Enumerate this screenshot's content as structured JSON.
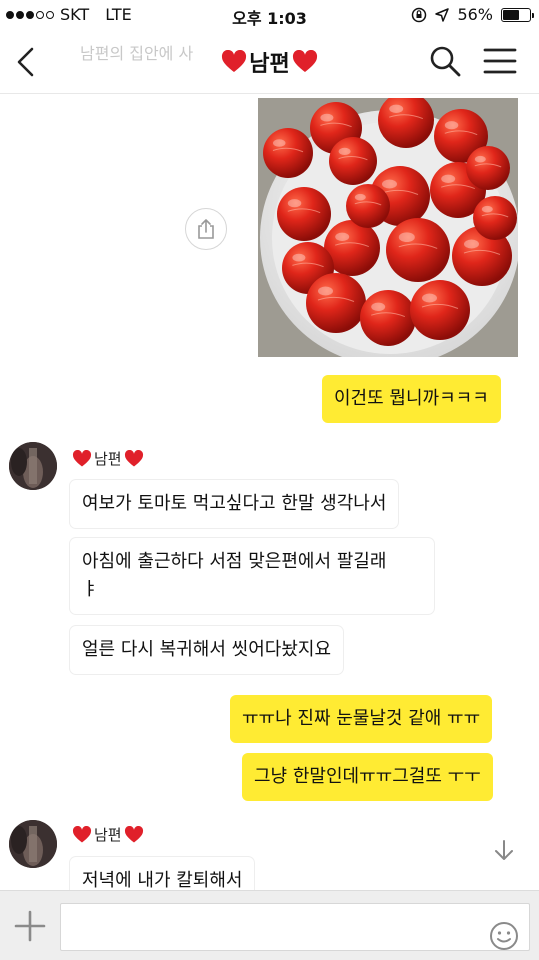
{
  "status_bar": {
    "carrier": "SKT",
    "network": "LTE",
    "time": "오후 1:03",
    "battery": "56%",
    "battery_level": 0.56
  },
  "header": {
    "title": "남편",
    "ghost_text": "남편의 집안에 사"
  },
  "messages": {
    "me_1": "이건또 뭡니까ㅋㅋㅋ",
    "sender_1": "남편",
    "them_1": "여보가 토마토 먹고싶다고 한말 생각나서",
    "them_2_line1": "아침에 출근하다 서점 맞은편에서 팔길래",
    "them_2_line2": "ㅑ",
    "them_3": "얼른 다시 복귀해서 씻어다놨지요",
    "me_2": "ㅠㅠ나 진짜 눈물날것 같애 ㅠㅠ",
    "me_3": "그냥 한말인데ㅠㅠ그걸또 ㅜㅜ",
    "sender_2": "남편",
    "them_4": "저녁에 내가 칼퇴해서"
  },
  "colors": {
    "my_bubble": "#ffeb33",
    "heart": "#e0202a",
    "input_bar": "#eeeeee"
  },
  "icons": [
    "back-arrow-icon",
    "search-icon",
    "menu-icon",
    "share-icon",
    "heart-icon",
    "arrow-down-icon",
    "plus-icon",
    "emoji-icon",
    "hash-icon"
  ]
}
